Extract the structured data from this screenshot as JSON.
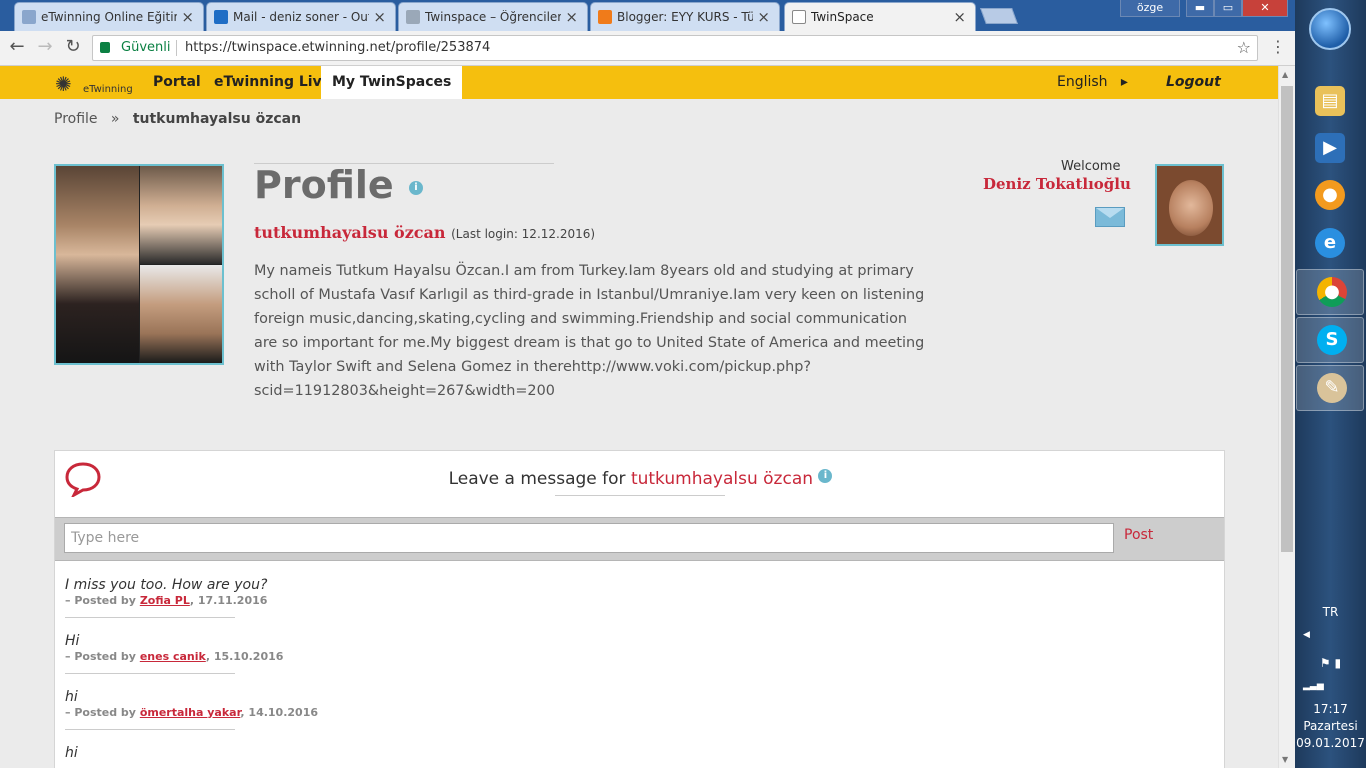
{
  "browser": {
    "tabs": [
      {
        "title": "eTwinning Online Eğitim",
        "fav_color": "#8aa6cc"
      },
      {
        "title": "Mail - deniz soner - Outlo",
        "fav_color": "#1f6dc5"
      },
      {
        "title": "Twinspace – Öğrenciler i",
        "fav_color": "#9aa8b8"
      },
      {
        "title": "Blogger: EYY KURS - Tüm",
        "fav_color": "#f07b1a"
      },
      {
        "title": "TwinSpace",
        "fav_color": "#ffffff"
      }
    ],
    "tab_close": "×",
    "user_badge": "özge",
    "win_min": "▬",
    "win_max": "▭",
    "win_close": "✕",
    "secure_label": "Güvenli",
    "url": "https://twinspace.etwinning.net/profile/253874"
  },
  "nav": {
    "logo_text": "eTwinning",
    "portal": "Portal",
    "live": "eTwinning Live",
    "twinspaces": "My TwinSpaces",
    "language": "English",
    "language_arrow": "▸",
    "logout": "Logout"
  },
  "breadcrumb": {
    "root": "Profile",
    "separator": "»",
    "current": "tutkumhayalsu özcan"
  },
  "profile": {
    "heading": "Profile",
    "info_glyph": "i",
    "username": "tutkumhayalsu özcan",
    "last_login": "(Last login: 12.12.2016)",
    "about": "My nameis Tutkum Hayalsu Özcan.I am from Turkey.Iam 8years old and studying at primary scholl of Mustafa Vasıf Karlıgil as third-grade in Istanbul/Umraniye.Iam very keen on listening foreign music,dancing,skating,cycling and swimming.Friendship and social communication are so important for me.My biggest dream is that go to United State of America and meeting with Taylor Swift and Selena Gomez in therehttp://www.voki.com/pickup.php?scid=11912803&height=267&width=200"
  },
  "welcome": {
    "label": "Welcome",
    "name": "Deniz Tokatlıoğlu"
  },
  "messages": {
    "title_prefix": "Leave a message for",
    "title_name": "tutkumhayalsu özcan",
    "placeholder": "Type here",
    "post_label": "Post",
    "posted_by": "– Posted by",
    "items": [
      {
        "text": "I miss you too. How are you?",
        "author": "Zofia PL",
        "date": ", 17.11.2016"
      },
      {
        "text": "Hi",
        "author": "enes canik",
        "date": ", 15.10.2016"
      },
      {
        "text": "hi",
        "author": "ömertalha yakar",
        "date": ", 14.10.2016"
      },
      {
        "text": "hi"
      }
    ]
  },
  "taskbar": {
    "language": "TR",
    "time": "17:17",
    "day": "Pazartesi",
    "date": "09.01.2017",
    "icons": [
      "explorer-icon",
      "media-player-icon",
      "messenger-icon",
      "internet-explorer-icon",
      "chrome-icon",
      "skype-icon",
      "paint-icon"
    ]
  },
  "colors": {
    "accent_red": "#c8283a",
    "navbar_yellow": "#f5bf0e",
    "frame_teal": "#6cc0cf"
  }
}
